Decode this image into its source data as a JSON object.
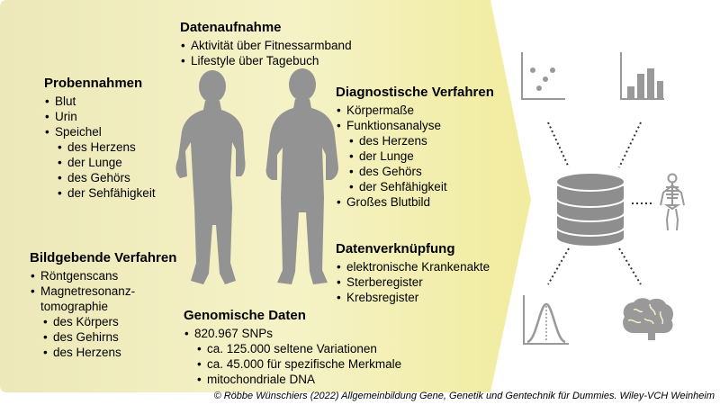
{
  "colors": {
    "background": "#ffffff",
    "panel_fill": "#f5f2c7",
    "silhouette": "#939393",
    "icon_gray": "#b0b0b0"
  },
  "blocks": {
    "datenaufnahme": {
      "title": "Datenaufnahme",
      "items": [
        "Aktivität über Fitnessarmband",
        "Lifestyle über Tagebuch"
      ]
    },
    "probennahmen": {
      "title": "Probennahmen",
      "items": [
        "Blut",
        "Urin",
        "Speichel"
      ],
      "sub_items": [
        "des Herzens",
        "der Lunge",
        "des Gehörs",
        "der Sehfähigkeit"
      ]
    },
    "diagnostik": {
      "title": "Diagnostische Verfahren",
      "items": [
        "Körpermaße",
        "Funktionsanalyse"
      ],
      "sub_items": [
        "des Herzens",
        "der Lunge",
        "des Gehörs",
        "der Sehfähigkeit"
      ],
      "last_item": "Großes Blutbild"
    },
    "bildgebung": {
      "title": "Bildgebende Verfahren",
      "items": [
        "Röntgenscans",
        "Magnetresonanz-"
      ],
      "continuation": "tomographie",
      "sub_items": [
        "des Körpers",
        "des Gehirns",
        "des Herzens"
      ]
    },
    "datenverknuepfung": {
      "title": "Datenverknüpfung",
      "items": [
        "elektronische Krankenakte",
        "Sterberegister",
        "Krebsregister"
      ]
    },
    "genomik": {
      "title": "Genomische Daten",
      "items": [
        "820.967 SNPs"
      ],
      "sub_items": [
        "ca. 125.000 seltene Variationen",
        "ca. 45.000 für spezifische Merkmale",
        "mitochondriale DNA"
      ]
    }
  },
  "icons": [
    "scatter-plot-icon",
    "bar-chart-icon",
    "database-icon",
    "skeleton-icon",
    "bell-curve-icon",
    "brain-icon",
    "female-silhouette",
    "male-silhouette"
  ],
  "credit": "© Röbbe Wünschiers (2022) Allgemeinbildung Gene, Genetik und Gentechnik für Dummies. Wiley-VCH Weinheim"
}
